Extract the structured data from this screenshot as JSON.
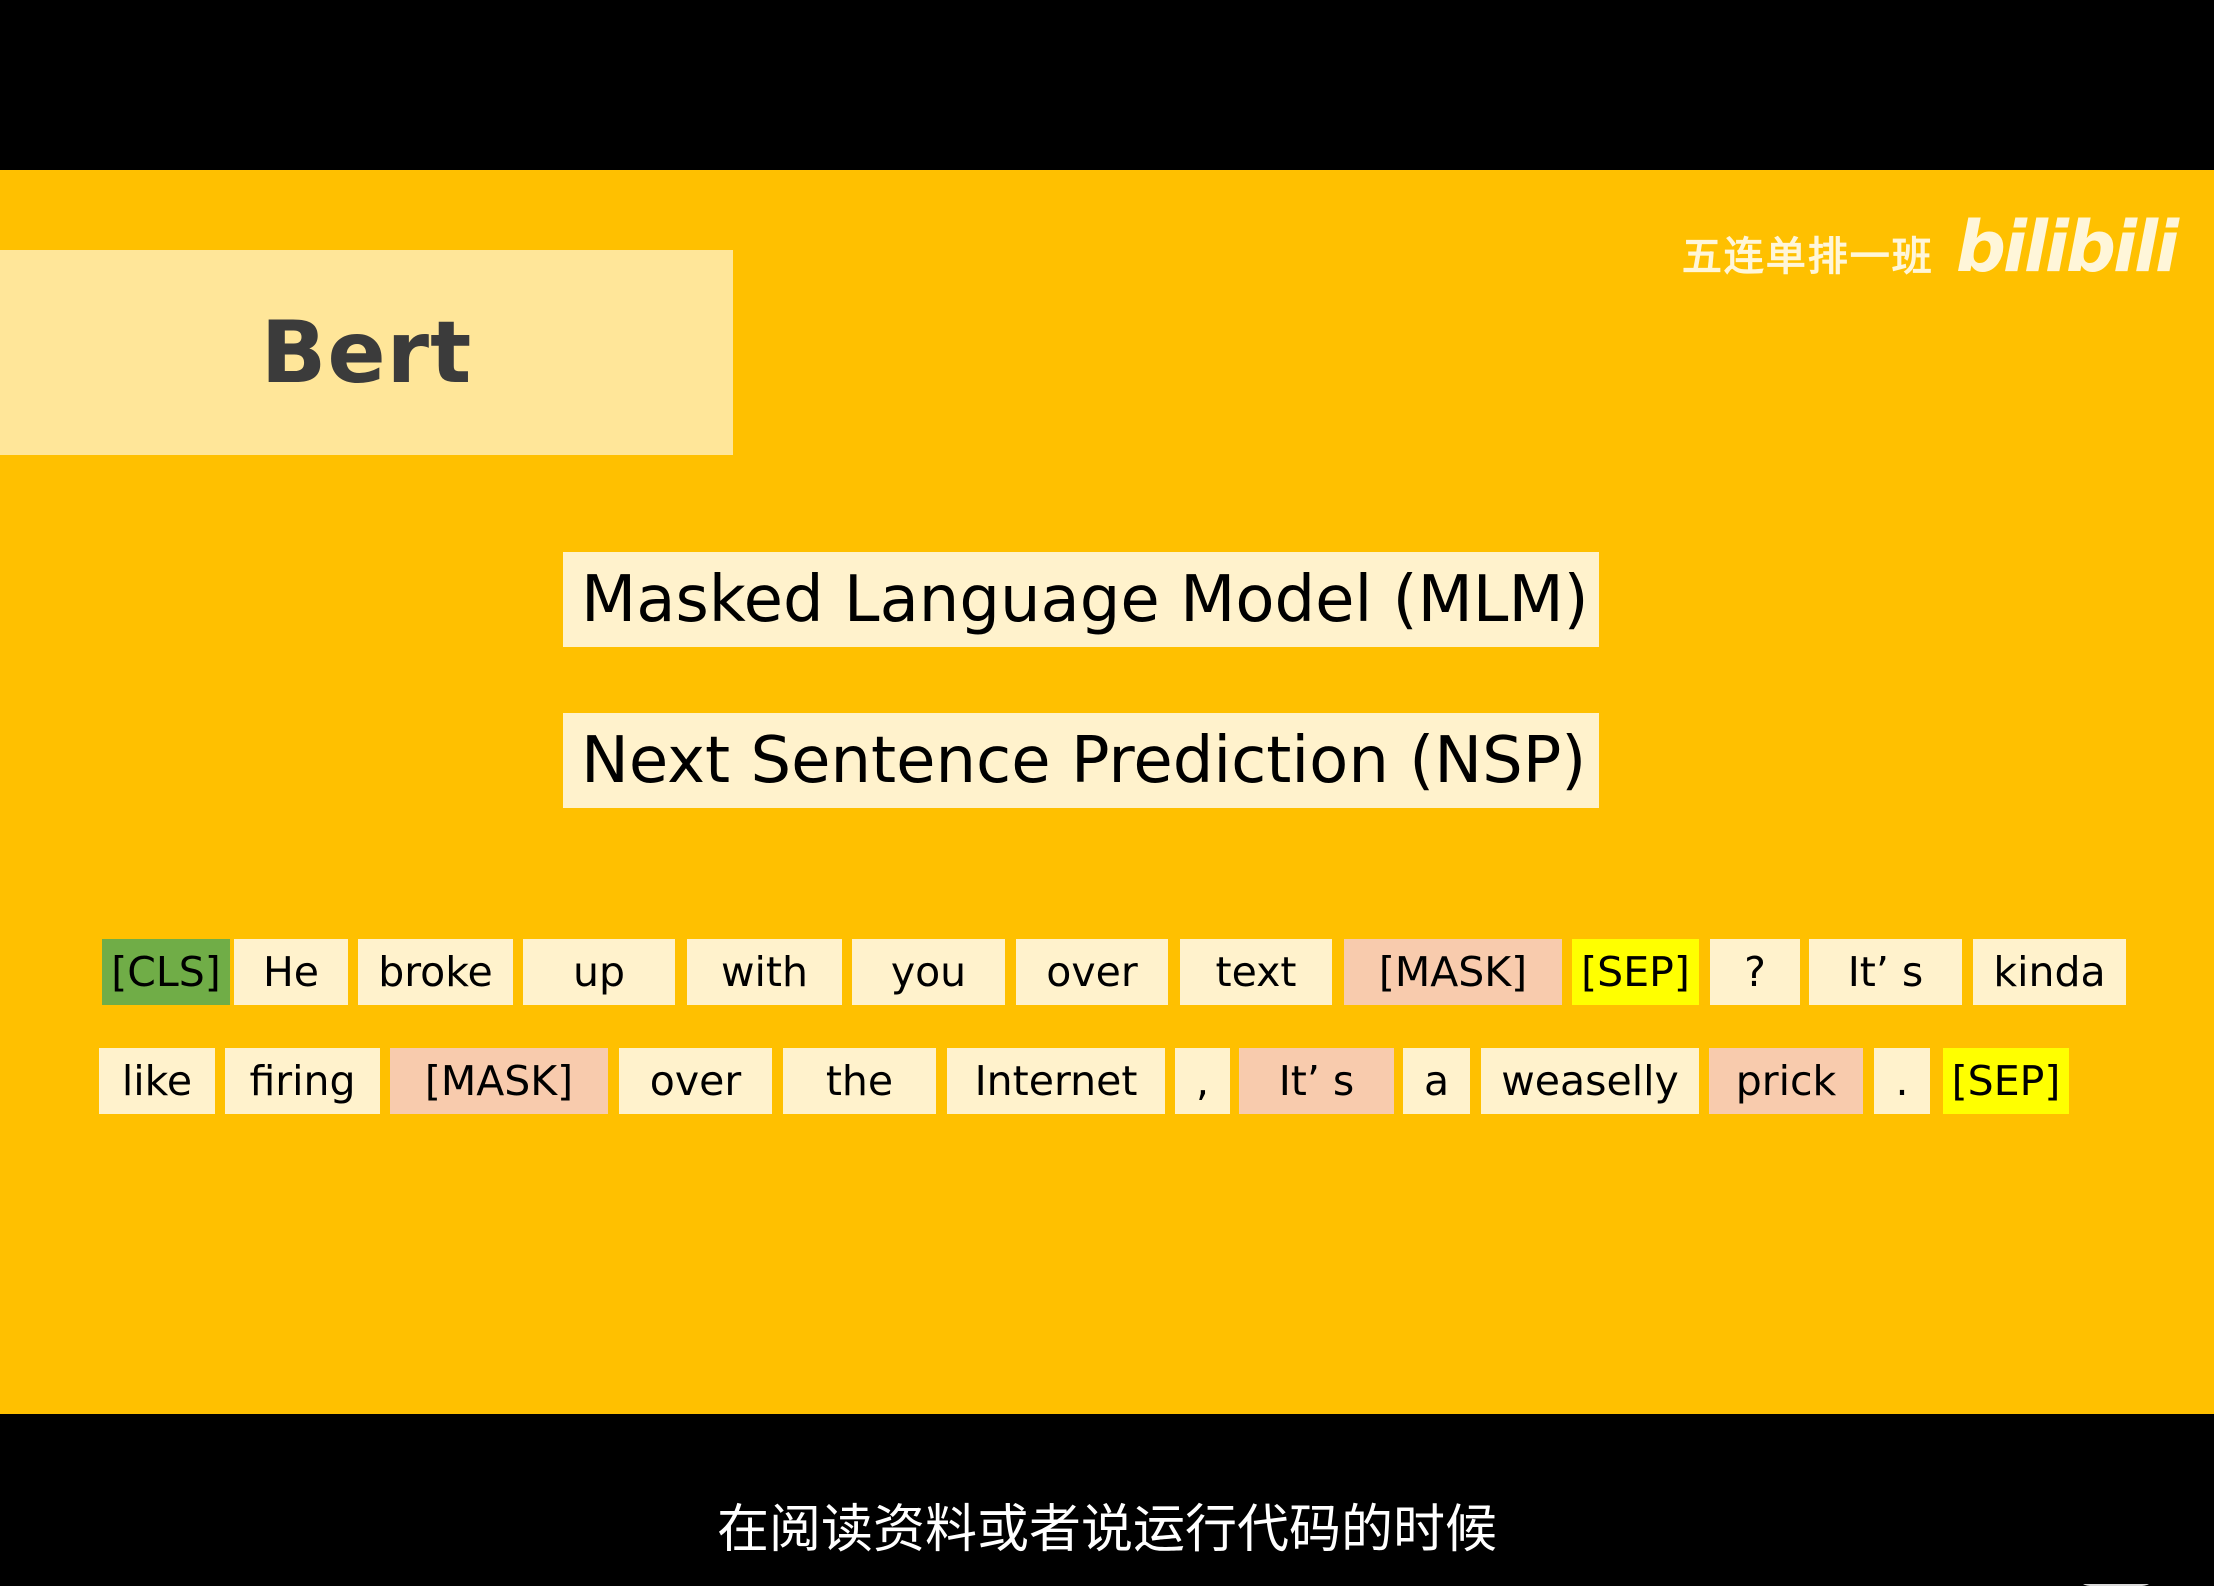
{
  "slide": {
    "title": "Bert",
    "watermark_text": "五连单排一班",
    "watermark_logo": "bilibili",
    "tasks": {
      "mlm": "Masked Language Model (MLM)",
      "nsp": "Next Sentence Prediction (NSP)"
    },
    "tokens": [
      "[CLS]",
      "He",
      "broke",
      "up",
      "with",
      "you",
      "over",
      "text",
      "[MASK]",
      "[SEP]",
      "?",
      "It’ s",
      "kinda",
      "like",
      "firing",
      "[MASK]",
      "over",
      "the",
      "Internet",
      ",",
      "It’ s",
      "a",
      "weaselly",
      "prick",
      ".",
      "[SEP]"
    ],
    "colors": {
      "background": "#FFC000",
      "title_box": "#FFE699",
      "token": "#FFF2CC",
      "cls": "#70AD47",
      "sep": "#FFFF00",
      "mask": "#F8CBAD"
    }
  },
  "subtitle": "在阅读资料或者说运行代码的时候",
  "player": {
    "badge_icon": "tv-play-icon"
  }
}
